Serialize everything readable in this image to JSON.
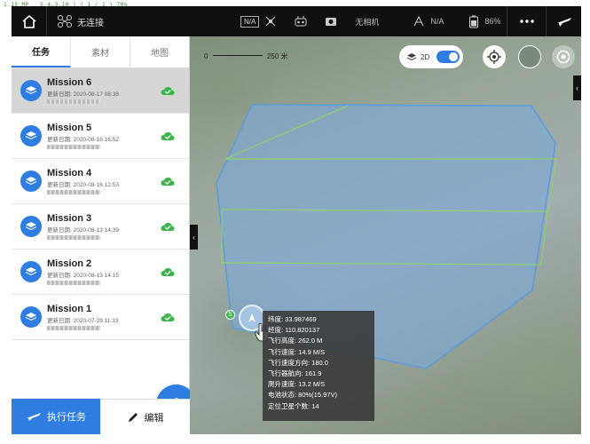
{
  "status_line": "1.15 MP , 5,4,3,10 ) ( 1 / 1 )  70%",
  "topbar": {
    "connection": "无连接",
    "camera_status": "无相机",
    "signal_na": "N/A",
    "gps_na": "N/A",
    "battery": "86%",
    "na_box": "N/A"
  },
  "sidebar": {
    "tabs": [
      "任务",
      "素材",
      "地图"
    ],
    "missions": [
      {
        "title": "Mission 6",
        "date": "更新日期: 2020-08-17 08:38"
      },
      {
        "title": "Mission 5",
        "date": "更新日期: 2020-08-16 16:52"
      },
      {
        "title": "Mission 4",
        "date": "更新日期: 2020-08-16 12:53"
      },
      {
        "title": "Mission 3",
        "date": "更新日期: 2020-08-13 14:39"
      },
      {
        "title": "Mission 2",
        "date": "更新日期: 2020-08-13 14:15"
      },
      {
        "title": "Mission 1",
        "date": "更新日期: 2020-07-29 11:33"
      }
    ],
    "execute_label": "执行任务",
    "edit_label": "编辑"
  },
  "map": {
    "scale_label": "250 米",
    "scale_zero": "0",
    "view_mode": "2D",
    "waypoint_label": "S",
    "info": [
      "纬度: 33.987469",
      "经度: 110.820137",
      "飞行高度: 262.0 M",
      "飞行速度: 14.9 M/S",
      "飞行速度方向: 180.0",
      "飞行器航向: 161.9",
      "爬升速度: 13.2 M/S",
      "电池状态: 80%(15.97V)",
      "定位卫星个数: 14"
    ]
  },
  "colors": {
    "accent": "#2f7de1",
    "topbar": "#101010",
    "cloud_check": "#3bb54a",
    "polygon_fill": "#7ea9d8",
    "flight_line": "#8fd16b"
  }
}
